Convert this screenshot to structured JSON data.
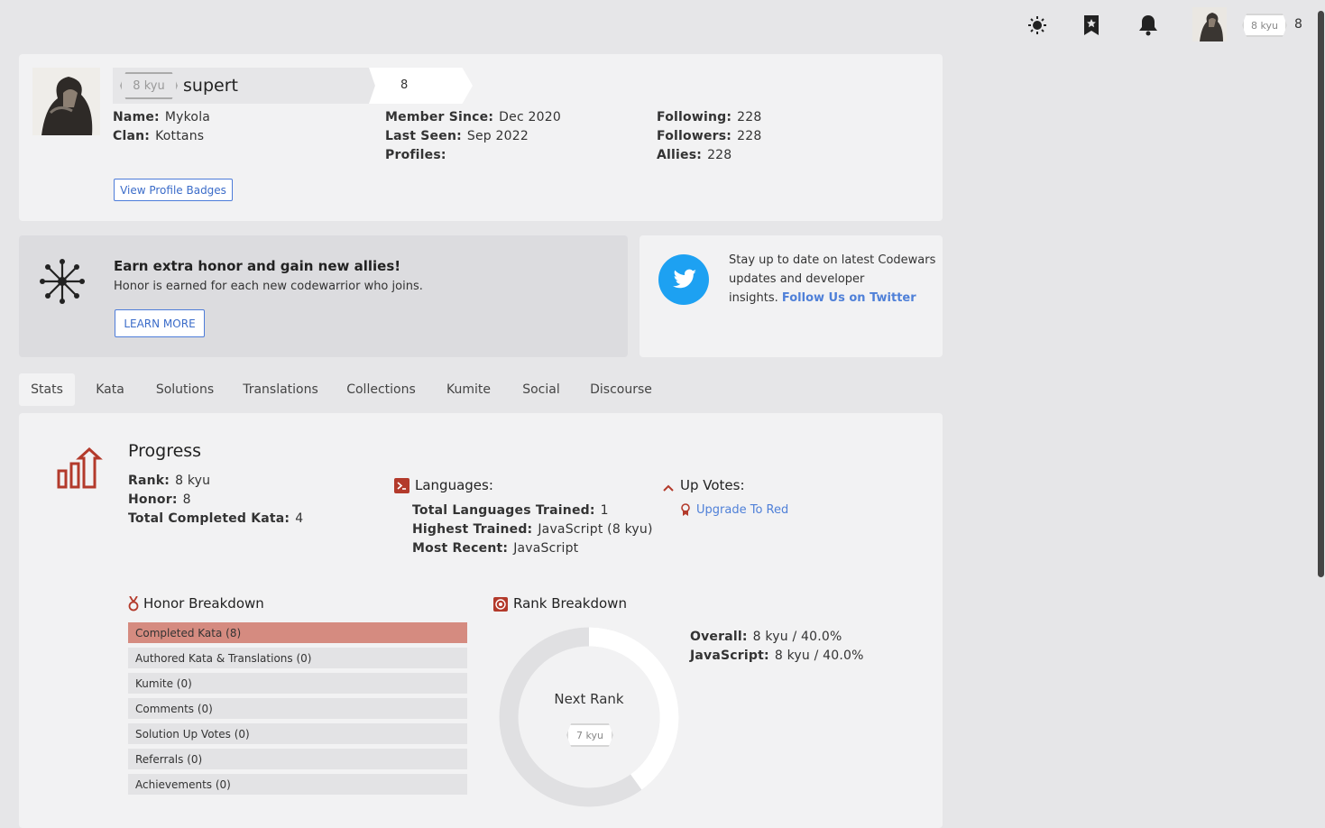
{
  "topbar": {
    "icons": [
      "sun-icon",
      "bookmark-star-icon",
      "bell-icon"
    ],
    "rank": "8 kyu",
    "honor": "8"
  },
  "profile": {
    "rank": "8 kyu",
    "username": "supert",
    "honor": "8",
    "name_label": "Name:",
    "name": "Mykola",
    "clan_label": "Clan:",
    "clan": "Kottans",
    "member_since_label": "Member Since:",
    "member_since": "Dec 2020",
    "last_seen_label": "Last Seen:",
    "last_seen": "Sep 2022",
    "profiles_label": "Profiles:",
    "following_label": "Following:",
    "following": "228",
    "followers_label": "Followers:",
    "followers": "228",
    "allies_label": "Allies:",
    "allies": "228",
    "badges_button": "View Profile Badges"
  },
  "promo": {
    "title": "Earn extra honor and gain new allies!",
    "subtitle": "Honor is earned for each new codewarrior who joins.",
    "button": "LEARN MORE"
  },
  "twitter": {
    "text1": "Stay up to date on latest Codewars",
    "text2": "updates and developer",
    "text3": "insights.",
    "link": "Follow Us on Twitter"
  },
  "tabs": [
    "Stats",
    "Kata",
    "Solutions",
    "Translations",
    "Collections",
    "Kumite",
    "Social",
    "Discourse"
  ],
  "progress": {
    "title": "Progress",
    "rank_label": "Rank:",
    "rank": "8 kyu",
    "honor_label": "Honor:",
    "honor": "8",
    "completed_label": "Total Completed Kata:",
    "completed": "4"
  },
  "languages": {
    "title": "Languages:",
    "trained_label": "Total Languages Trained:",
    "trained": "1",
    "highest_label": "Highest Trained:",
    "highest": "JavaScript (8 kyu)",
    "recent_label": "Most Recent:",
    "recent": "JavaScript"
  },
  "upvotes": {
    "title": "Up Votes:",
    "link": "Upgrade To Red"
  },
  "honor_breakdown": {
    "title": "Honor Breakdown",
    "rows": [
      "Completed Kata (8)",
      "Authored Kata & Translations (0)",
      "Kumite (0)",
      "Comments (0)",
      "Solution Up Votes (0)",
      "Referrals (0)",
      "Achievements (0)"
    ]
  },
  "rank_breakdown": {
    "title": "Rank Breakdown",
    "center_label": "Next Rank",
    "next_rank": "7 kyu",
    "progress_fraction": 0.4,
    "overall_label": "Overall:",
    "overall": "8 kyu / 40.0%",
    "js_label": "JavaScript:",
    "js": "8 kyu / 40.0%"
  },
  "colors": {
    "accent_red": "#b33a2b",
    "link_blue": "#4f80d8",
    "twitter_blue": "#1da1f2"
  }
}
